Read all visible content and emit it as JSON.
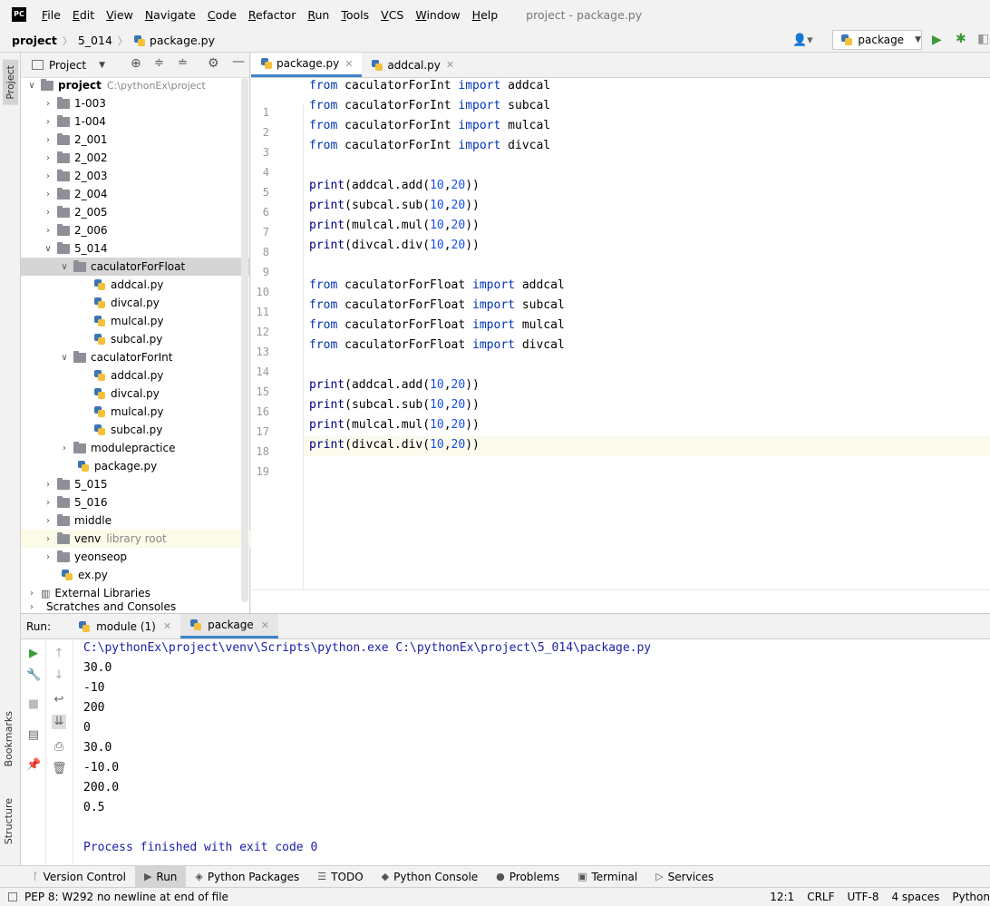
{
  "menubar": {
    "logo": "PC",
    "items": [
      "File",
      "Edit",
      "View",
      "Navigate",
      "Code",
      "Refactor",
      "Run",
      "Tools",
      "VCS",
      "Window",
      "Help"
    ],
    "window_title": "project - package.py"
  },
  "navbar": {
    "crumbs": [
      "project",
      "5_014",
      "package.py"
    ],
    "run_config": "package"
  },
  "side_tabs": {
    "project": "Project",
    "bookmarks": "Bookmarks",
    "structure": "Structure"
  },
  "project_panel": {
    "title": "Project",
    "root_name": "project",
    "root_path": "C:\\pythonEx\\project",
    "folders_top": [
      "1-003",
      "1-004",
      "2_001",
      "2_002",
      "2_003",
      "2_004",
      "2_005",
      "2_006",
      "5_014"
    ],
    "float_folder": "caculatorForFloat",
    "float_files": [
      "addcal.py",
      "divcal.py",
      "mulcal.py",
      "subcal.py"
    ],
    "int_folder": "caculatorForInt",
    "int_files": [
      "addcal.py",
      "divcal.py",
      "mulcal.py",
      "subcal.py"
    ],
    "modulepractice": "modulepractice",
    "package_file": "package.py",
    "folders_bottom": [
      "5_015",
      "5_016",
      "middle"
    ],
    "venv": "venv",
    "venv_note": "library root",
    "yeonseop": "yeonseop",
    "ex_file": "ex.py",
    "external": "External Libraries",
    "scratches": "Scratches and Consoles"
  },
  "editor": {
    "tabs": [
      "package.py",
      "addcal.py"
    ],
    "lines": [
      {
        "kw1": "from",
        "mod": " caculatorForInt ",
        "kw2": "import",
        "name": " addcal"
      },
      {
        "kw1": "from",
        "mod": " caculatorForInt ",
        "kw2": "import",
        "name": " subcal"
      },
      {
        "kw1": "from",
        "mod": " caculatorForInt ",
        "kw2": "import",
        "name": " mulcal"
      },
      {
        "kw1": "from",
        "mod": " caculatorForInt ",
        "kw2": "import",
        "name": " divcal"
      },
      {
        "blank": true
      },
      {
        "fn": "print",
        "call": "(addcal.add(",
        "a": "10",
        "b": "20",
        "end": "))"
      },
      {
        "fn": "print",
        "call": "(subcal.sub(",
        "a": "10",
        "b": "20",
        "end": "))"
      },
      {
        "fn": "print",
        "call": "(mulcal.mul(",
        "a": "10",
        "b": "20",
        "end": "))"
      },
      {
        "fn": "print",
        "call": "(divcal.div(",
        "a": "10",
        "b": "20",
        "end": "))"
      },
      {
        "blank": true
      },
      {
        "kw1": "from",
        "mod": " caculatorForFloat ",
        "kw2": "import",
        "name": " addcal"
      },
      {
        "kw1": "from",
        "mod": " caculatorForFloat ",
        "kw2": "import",
        "name": " subcal"
      },
      {
        "kw1": "from",
        "mod": " caculatorForFloat ",
        "kw2": "import",
        "name": " mulcal"
      },
      {
        "kw1": "from",
        "mod": " caculatorForFloat ",
        "kw2": "import",
        "name": " divcal"
      },
      {
        "blank": true
      },
      {
        "fn": "print",
        "call": "(addcal.add(",
        "a": "10",
        "b": "20",
        "end": "))"
      },
      {
        "fn": "print",
        "call": "(subcal.sub(",
        "a": "10",
        "b": "20",
        "end": "))"
      },
      {
        "fn": "print",
        "call": "(mulcal.mul(",
        "a": "10",
        "b": "20",
        "end": "))"
      },
      {
        "fn": "print",
        "call": "(divcal.div(",
        "a": "10",
        "b": "20",
        "end": "))"
      }
    ],
    "current_line": 19
  },
  "run_panel": {
    "label": "Run:",
    "tabs": [
      "module (1)",
      "package"
    ],
    "output": [
      "C:\\pythonEx\\project\\venv\\Scripts\\python.exe C:\\pythonEx\\project\\5_014\\package.py",
      "30.0",
      "-10",
      "200",
      "0",
      "30.0",
      "-10.0",
      "200.0",
      "0.5",
      "",
      "Process finished with exit code 0"
    ]
  },
  "bottom_tabs": [
    "Version Control",
    "Run",
    "Python Packages",
    "TODO",
    "Python Console",
    "Problems",
    "Terminal",
    "Services"
  ],
  "statusbar": {
    "message": "PEP 8: W292 no newline at end of file",
    "position": "12:1",
    "line_sep": "CRLF",
    "encoding": "UTF-8",
    "indent": "4 spaces",
    "interpreter": "Python"
  }
}
